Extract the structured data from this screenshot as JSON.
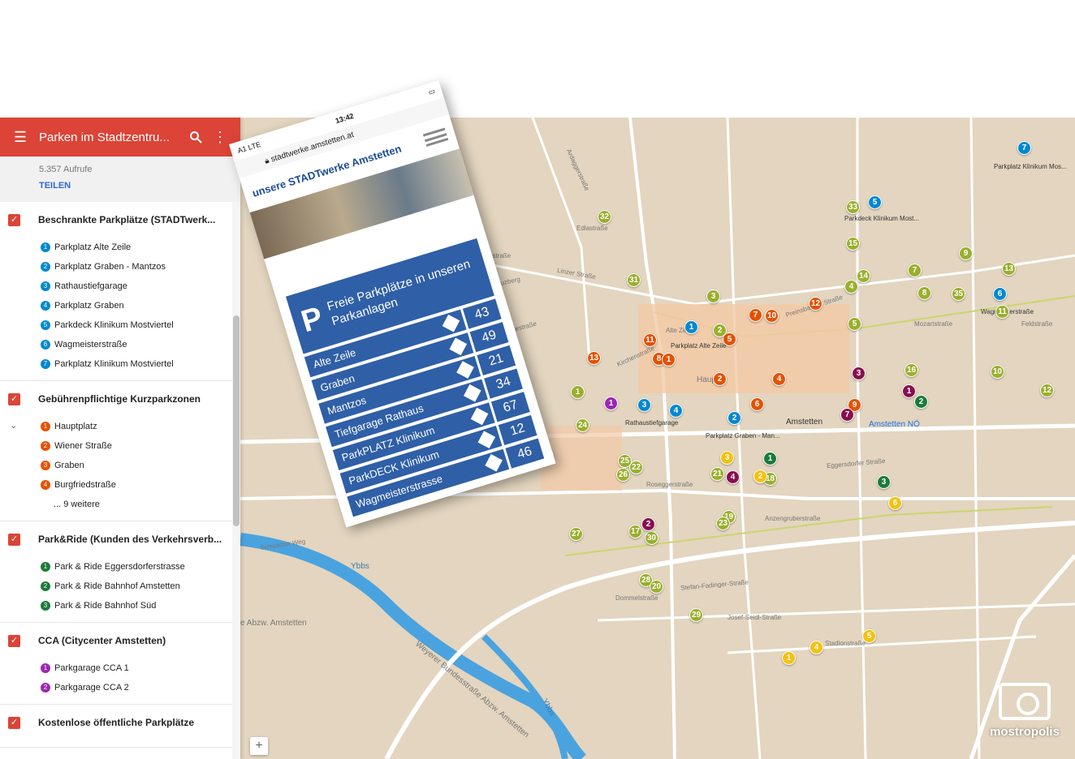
{
  "sidebar": {
    "title": "Parken im Stadtzentru...",
    "views": "5.357 Aufrufe",
    "share": "TEILEN",
    "layers": [
      {
        "title": "Beschrankte Parkplätze (STADTwerk...",
        "color": "#0288d1",
        "items": [
          "Parkplatz Alte Zeile",
          "Parkplatz Graben - Mantzos",
          "Rathaustiefgarage",
          "Parkplatz Graben",
          "Parkdeck Klinikum Mostviertel",
          "Wagmeisterstraße",
          "Parkplatz Klinikum Mostviertel"
        ],
        "more": ""
      },
      {
        "title": "Gebührenpflichtige Kurzparkzonen",
        "color": "#e65100",
        "items": [
          "Hauptplatz",
          "Wiener Straße",
          "Graben",
          "Burgfriedstraße"
        ],
        "more": "... 9 weitere"
      },
      {
        "title": "Park&Ride (Kunden des Verkehrsverb...",
        "color": "#1b7a3a",
        "items": [
          "Park & Ride Eggersdorferstrasse",
          "Park & Ride Bahnhof Amstetten",
          "Park & Ride Bahnhof Süd"
        ],
        "more": ""
      },
      {
        "title": "CCA (Citycenter Amstetten)",
        "color": "#9c27b0",
        "items": [
          "Parkgarage CCA 1",
          "Parkgarage CCA 2"
        ],
        "more": ""
      },
      {
        "title": "Kostenlose öffentliche Parkplätze",
        "color": "#9aaf2c",
        "items": [],
        "more": ""
      }
    ]
  },
  "phone": {
    "carrier": "A1",
    "network": "LTE",
    "time": "13:42",
    "url": "stadtwerke.amstetten.at",
    "brand": "unsere STADTwerke Amstetten",
    "heading_p": "P",
    "heading": "Freie Parkplätze in unseren Parkanlagen",
    "rows": [
      {
        "name": "Alte Zeile",
        "free": "43"
      },
      {
        "name": "Graben",
        "free": "49"
      },
      {
        "name": "Mantzos",
        "free": "21"
      },
      {
        "name": "Tiefgarage Rathaus",
        "free": "34"
      },
      {
        "name": "ParkPLATZ Klinikum",
        "free": "67"
      },
      {
        "name": "ParkDECK Klinikum",
        "free": "12"
      },
      {
        "name": "Wagmeisterstrasse",
        "free": "46"
      }
    ]
  },
  "map": {
    "zoom_in": "+",
    "labels": {
      "alte_zeile": "Parkplatz Alte Zeile",
      "rathaus": "Rathaustiefgarage",
      "graben_mantzos": "Parkplatz Graben - Man...",
      "parkdeck": "Parkdeck Klinikum Most...",
      "klinikum": "Parkplatz Klinikum Mos...",
      "wagmeister": "Wagmeisterstraße",
      "amstetten": "Amstetten",
      "amstetten_no": "Amstetten NÖ",
      "ybbs_river": "Ybbs",
      "ybbs2": "Ybbs",
      "abzw": "e Abzw. Amstetten",
      "weyerer": "Weyerer Bundesstraße Abzw. Amstetten",
      "linzer": "Linzer Straße",
      "haupt": "Haupt",
      "alte_z": "Alte Zeile",
      "eggersdorfer": "Eggersdorfer Straße",
      "stadionstr": "Stadionstraße",
      "josef": "Josef-Seidl-Straße",
      "anzengruber": "Anzengruberstraße",
      "rosegger": "Roseggerstraße",
      "dommel": "Dommelstraße",
      "hamerling": "Hamerlingstraße",
      "kreuzberg": "Am Kreuzberg",
      "heinestr": "Heinestraße",
      "mozart": "Mozartstraße",
      "feldstr": "Feldstraße",
      "kirchenstr": "Kirchenstraße",
      "ardagger": "Ardaggerstraße",
      "preinsbacher": "Preinsbacher Straße",
      "fadinger": "Stefan-Fadinger-Straße",
      "edlastr": "Edlastraße",
      "schwarzer": "Schwarzer Weg"
    }
  },
  "pins": [
    {
      "n": "7",
      "c": "#0288d1"
    },
    {
      "n": "5",
      "c": "#0288d1"
    },
    {
      "n": "6",
      "c": "#0288d1"
    },
    {
      "n": "1",
      "c": "#0288d1"
    },
    {
      "n": "3",
      "c": "#0288d1"
    },
    {
      "n": "4",
      "c": "#0288d1"
    },
    {
      "n": "2",
      "c": "#0288d1"
    },
    {
      "n": "7",
      "c": "#e65100"
    },
    {
      "n": "10",
      "c": "#e65100"
    },
    {
      "n": "12",
      "c": "#e65100"
    },
    {
      "n": "5",
      "c": "#e65100"
    },
    {
      "n": "11",
      "c": "#e65100"
    },
    {
      "n": "8",
      "c": "#e65100"
    },
    {
      "n": "1",
      "c": "#e65100"
    },
    {
      "n": "13",
      "c": "#e65100"
    },
    {
      "n": "2",
      "c": "#e65100"
    },
    {
      "n": "4",
      "c": "#e65100"
    },
    {
      "n": "6",
      "c": "#e65100"
    },
    {
      "n": "9",
      "c": "#e65100"
    },
    {
      "n": "33",
      "c": "#9aaf2c"
    },
    {
      "n": "32",
      "c": "#9aaf2c"
    },
    {
      "n": "15",
      "c": "#9aaf2c"
    },
    {
      "n": "14",
      "c": "#9aaf2c"
    },
    {
      "n": "4",
      "c": "#9aaf2c"
    },
    {
      "n": "7",
      "c": "#9aaf2c"
    },
    {
      "n": "9",
      "c": "#9aaf2c"
    },
    {
      "n": "13",
      "c": "#9aaf2c"
    },
    {
      "n": "31",
      "c": "#9aaf2c"
    },
    {
      "n": "3",
      "c": "#9aaf2c"
    },
    {
      "n": "8",
      "c": "#9aaf2c"
    },
    {
      "n": "35",
      "c": "#9aaf2c"
    },
    {
      "n": "11",
      "c": "#9aaf2c"
    },
    {
      "n": "5",
      "c": "#9aaf2c"
    },
    {
      "n": "2",
      "c": "#9aaf2c"
    },
    {
      "n": "16",
      "c": "#9aaf2c"
    },
    {
      "n": "10",
      "c": "#9aaf2c"
    },
    {
      "n": "12",
      "c": "#9aaf2c"
    },
    {
      "n": "1",
      "c": "#9aaf2c"
    },
    {
      "n": "24",
      "c": "#9aaf2c"
    },
    {
      "n": "25",
      "c": "#9aaf2c"
    },
    {
      "n": "22",
      "c": "#9aaf2c"
    },
    {
      "n": "26",
      "c": "#9aaf2c"
    },
    {
      "n": "21",
      "c": "#9aaf2c"
    },
    {
      "n": "18",
      "c": "#9aaf2c"
    },
    {
      "n": "19",
      "c": "#9aaf2c"
    },
    {
      "n": "23",
      "c": "#9aaf2c"
    },
    {
      "n": "27",
      "c": "#9aaf2c"
    },
    {
      "n": "17",
      "c": "#9aaf2c"
    },
    {
      "n": "30",
      "c": "#9aaf2c"
    },
    {
      "n": "28",
      "c": "#9aaf2c"
    },
    {
      "n": "20",
      "c": "#9aaf2c"
    },
    {
      "n": "29",
      "c": "#9aaf2c"
    },
    {
      "n": "3",
      "c": "#880e4f"
    },
    {
      "n": "1",
      "c": "#880e4f"
    },
    {
      "n": "7",
      "c": "#880e4f"
    },
    {
      "n": "6",
      "c": "#880e4f"
    },
    {
      "n": "4",
      "c": "#880e4f"
    },
    {
      "n": "2",
      "c": "#880e4f"
    },
    {
      "n": "2",
      "c": "#1b7a3a"
    },
    {
      "n": "1",
      "c": "#1b7a3a"
    },
    {
      "n": "3",
      "c": "#1b7a3a"
    },
    {
      "n": "1",
      "c": "#9c27b0"
    },
    {
      "n": "2",
      "c": "#9c27b0"
    },
    {
      "n": "3",
      "c": "#f4c20d"
    },
    {
      "n": "2",
      "c": "#f4c20d"
    },
    {
      "n": "6",
      "c": "#f4c20d"
    },
    {
      "n": "1",
      "c": "#f4c20d"
    },
    {
      "n": "4",
      "c": "#f4c20d"
    },
    {
      "n": "5",
      "c": "#f4c20d"
    }
  ],
  "watermark": "mostropolis"
}
